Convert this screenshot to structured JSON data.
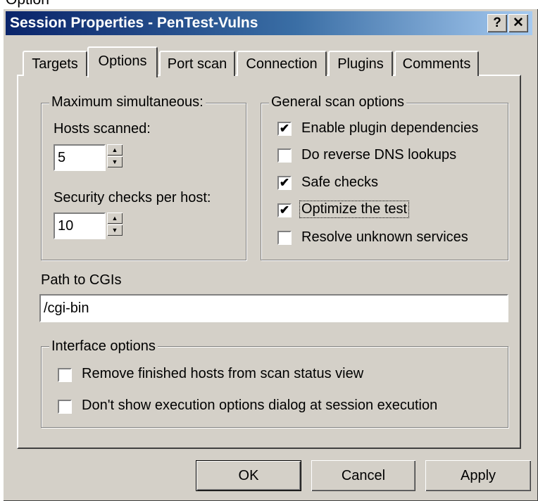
{
  "window": {
    "title": "Session Properties - PenTest-Vulns",
    "help_label": "?",
    "close_label": "✕"
  },
  "top_fragment": "Option",
  "tabs": [
    {
      "label": "Targets",
      "active": false
    },
    {
      "label": "Options",
      "active": true
    },
    {
      "label": "Port scan",
      "active": false
    },
    {
      "label": "Connection",
      "active": false
    },
    {
      "label": "Plugins",
      "active": false
    },
    {
      "label": "Comments",
      "active": false
    }
  ],
  "max_simultaneous": {
    "legend": "Maximum simultaneous:",
    "hosts_label": "Hosts scanned:",
    "hosts_value": "5",
    "checks_label": "Security checks per host:",
    "checks_value": "10"
  },
  "general_options": {
    "legend": "General scan options",
    "items": [
      {
        "label": "Enable plugin dependencies",
        "checked": true
      },
      {
        "label": "Do reverse DNS lookups",
        "checked": false
      },
      {
        "label": "Safe checks",
        "checked": true
      },
      {
        "label": "Optimize the test",
        "checked": true
      },
      {
        "label": "Resolve unknown services",
        "checked": false
      }
    ]
  },
  "cgi": {
    "label": "Path to CGIs",
    "value": "/cgi-bin"
  },
  "interface_options": {
    "legend": "Interface options",
    "items": [
      {
        "label": "Remove finished hosts from scan status view",
        "checked": false
      },
      {
        "label": "Don't show execution options dialog at session execution",
        "checked": false
      }
    ]
  },
  "buttons": {
    "ok": "OK",
    "cancel": "Cancel",
    "apply": "Apply"
  },
  "check_glyph": "✔"
}
